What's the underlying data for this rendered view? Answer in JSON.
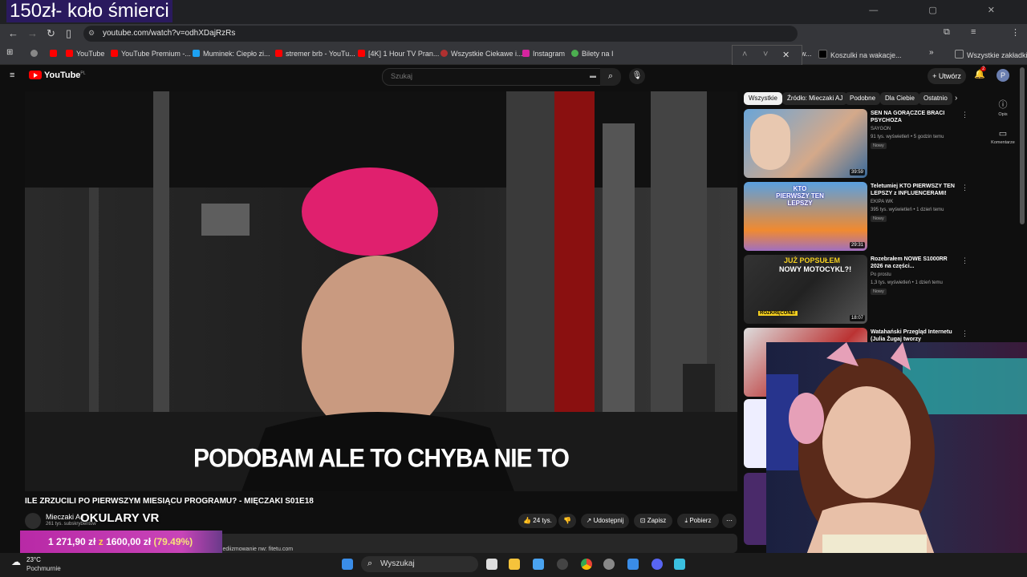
{
  "overlay_title": "150zł- koło śmierci",
  "browser": {
    "url": "youtube.com/watch?v=odhXDajRzRs",
    "bookmarks": [
      {
        "label": "",
        "color": "#888888"
      },
      {
        "label": "",
        "color": "#ff0000"
      },
      {
        "label": "YouTube",
        "color": "#ff0000"
      },
      {
        "label": "YouTube Premium -...",
        "color": "#ff0000"
      },
      {
        "label": "Muminek: Ciepło zi...",
        "color": "#1da1f2"
      },
      {
        "label": "stremer brb - YouTu...",
        "color": "#ff0000"
      },
      {
        "label": "[4K] 1 Hour TV Pran...",
        "color": "#ff0000"
      },
      {
        "label": "Wszystkie Ciekawe i...",
        "color": "#b03030"
      },
      {
        "label": "Instagram",
        "color": "#d6249f"
      },
      {
        "label": "Bilety na I",
        "color": "#4caf50"
      },
      {
        "label": "w...",
        "color": "#777777"
      },
      {
        "label": "Koszulki na wakacje...",
        "color": "#000000"
      },
      {
        "label": "Wszystkie zakładki",
        "color": "#999999"
      }
    ]
  },
  "youtube": {
    "logo_text": "YouTube",
    "logo_region": "PL",
    "search_placeholder": "Szukaj",
    "create_label": "Utwórz",
    "notif_count": "2",
    "avatar_letter": "P"
  },
  "video": {
    "subtitle": "PODOBAM ALE TO CHYBA NIE TO",
    "title": "ILE ZRZUCILI PO PIERWSZYM MIESIĄCU PROGRAMU? - MIĘCZAKI S01E18",
    "channel": "Mieczaki AJ",
    "subscribers": "261 tys. subskrybentów",
    "overlay_text": "OKULARY VR",
    "likes": "24 tys.",
    "share_label": "Udostępnij",
    "save_label": "Zapisz",
    "download_label": "Pobierz",
    "desc_snippet": "do: mediizmowanie nw: fitetu.com"
  },
  "donation": {
    "current": "1 271,90 zł",
    "separator": "z",
    "goal": "1600,00 zł",
    "percent": "(79.49%)",
    "progress": 0.7949
  },
  "chips": [
    "Wszystkie",
    "Źródło: Mieczaki AJ",
    "Podobne",
    "Dla Ciebie",
    "Ostatnio"
  ],
  "recommendations": [
    {
      "title": "SEN NA GORĄCZCE BRACI PSYCHOZA",
      "channel": "SAYGON",
      "views": "91 tys. wyświetleń • 5 godzin temu",
      "badge": "Nowy",
      "duration": "39:59"
    },
    {
      "title": "Teletumiej KTO PIERWSZY TEN LEPSZY z INFLUENCERAMI!",
      "channel": "EKIPA WK",
      "views": "395 tys. wyświetleń • 1 dzień temu",
      "badge": "Nowy",
      "duration": "29:31"
    },
    {
      "title": "Rozebrałem NOWE S1000RR 2026 na części...",
      "channel": "Po prostu",
      "views": "1,3 tys. wyświetleń • 1 dzień temu",
      "badge": "Nowy",
      "duration": "18:07"
    },
    {
      "title": "Watahański Przegląd Internetu (Julia Żugaj tworzy girlsband?)...",
      "channel": "",
      "views": "",
      "badge": "",
      "duration": ""
    }
  ],
  "thumb_texts": {
    "t2": "KTO PIERWSZY TEN LEPSZY",
    "t3a": "JUŻ POPSUŁEM",
    "t3b": "NOWY MOTOCYKL?!",
    "t3c": "ROZKRĘCONE!"
  },
  "rail": [
    {
      "label": "Opis",
      "icon": "info-icon"
    },
    {
      "label": "Komentarze",
      "icon": "comment-icon"
    }
  ],
  "taskbar": {
    "temp": "23°C",
    "weather": "Pochmurnie",
    "search": "Wyszukaj"
  }
}
